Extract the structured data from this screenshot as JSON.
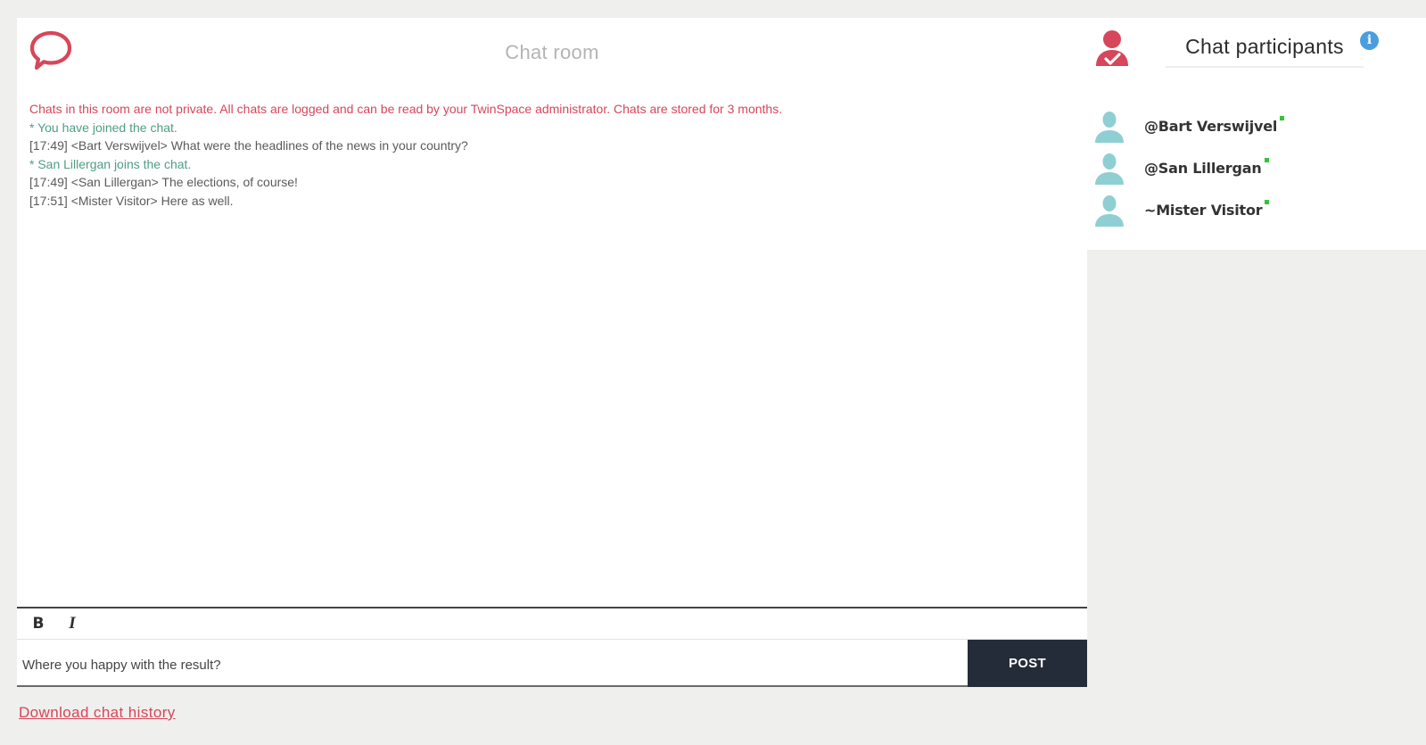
{
  "chat": {
    "title": "Chat room",
    "messages": [
      {
        "text": "Chats in this room are not private. All chats are logged and can be read by your TwinSpace administrator. Chats are stored for 3 months.",
        "kind": "notice"
      },
      {
        "text": "* You have joined the chat.",
        "kind": "system"
      },
      {
        "text": "[17:49] <Bart Verswijvel> What were the headlines of the news in your country?",
        "kind": "message"
      },
      {
        "text": "* San Lillergan joins the chat.",
        "kind": "system"
      },
      {
        "text": "[17:49] <San Lillergan> The elections, of course!",
        "kind": "message"
      },
      {
        "text": "[17:51] <Mister Visitor> Here as well.",
        "kind": "message"
      }
    ]
  },
  "composer": {
    "bold_label": "B",
    "italic_label": "I",
    "input_value": "Where you happy with the result?",
    "post_label": "POST"
  },
  "footer": {
    "download_label": "Download chat history"
  },
  "participants": {
    "title": "Chat participants",
    "info_label": "i",
    "list": [
      {
        "name": "@Bart Verswijvel",
        "online": true
      },
      {
        "name": "@San Lillergan",
        "online": true
      },
      {
        "name": "~Mister Visitor",
        "online": true
      }
    ]
  },
  "colors": {
    "accent": "#d7465a",
    "system": "#4f9d84",
    "post_button": "#252c39",
    "online": "#37c237",
    "info": "#4a9ee0",
    "avatar": "#8fcfd3"
  },
  "icons": {
    "chat_logo": "speech-bubble-icon",
    "participants": "user-check-icon",
    "avatar": "user-silhouette-icon",
    "info": "info-icon"
  }
}
